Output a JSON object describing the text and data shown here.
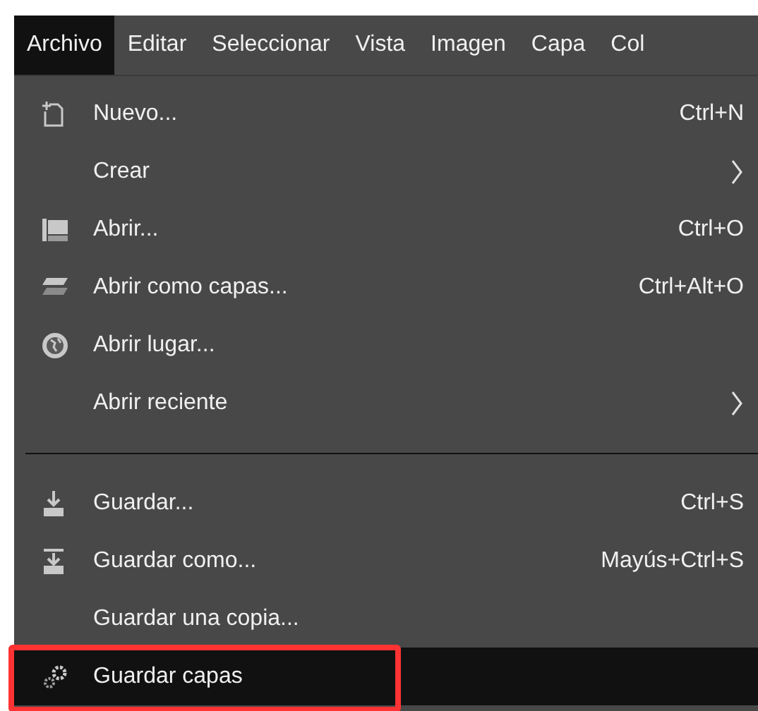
{
  "menubar": [
    {
      "label": "Archivo",
      "selected": true
    },
    {
      "label": "Editar",
      "selected": false
    },
    {
      "label": "Seleccionar",
      "selected": false
    },
    {
      "label": "Vista",
      "selected": false
    },
    {
      "label": "Imagen",
      "selected": false
    },
    {
      "label": "Capa",
      "selected": false
    },
    {
      "label": "Col",
      "selected": false
    }
  ],
  "menu": [
    {
      "kind": "item",
      "label": "Nuevo...",
      "shortcut": "Ctrl+N",
      "submenu": false,
      "selected": false,
      "outlined": false
    },
    {
      "kind": "item",
      "label": "Crear",
      "submenu": true,
      "selected": false,
      "outlined": false
    },
    {
      "kind": "item",
      "label": "Abrir...",
      "shortcut": "Ctrl+O",
      "submenu": false,
      "selected": false,
      "outlined": false
    },
    {
      "kind": "item",
      "label": "Abrir como capas...",
      "shortcut": "Ctrl+Alt+O",
      "submenu": false,
      "selected": false,
      "outlined": false
    },
    {
      "kind": "item",
      "label": "Abrir lugar...",
      "submenu": false,
      "selected": false,
      "outlined": false
    },
    {
      "kind": "item",
      "label": "Abrir reciente",
      "submenu": true,
      "selected": false,
      "outlined": false
    },
    {
      "kind": "separator"
    },
    {
      "kind": "item",
      "label": "Guardar...",
      "shortcut": "Ctrl+S",
      "submenu": false,
      "selected": false,
      "outlined": false
    },
    {
      "kind": "item",
      "label": "Guardar como...",
      "shortcut": "Mayús+Ctrl+S",
      "submenu": false,
      "selected": false,
      "outlined": false
    },
    {
      "kind": "item",
      "label": "Guardar una copia...",
      "submenu": false,
      "selected": false,
      "outlined": false
    },
    {
      "kind": "item",
      "label": "Guardar capas",
      "submenu": false,
      "selected": true,
      "outlined": true
    }
  ]
}
